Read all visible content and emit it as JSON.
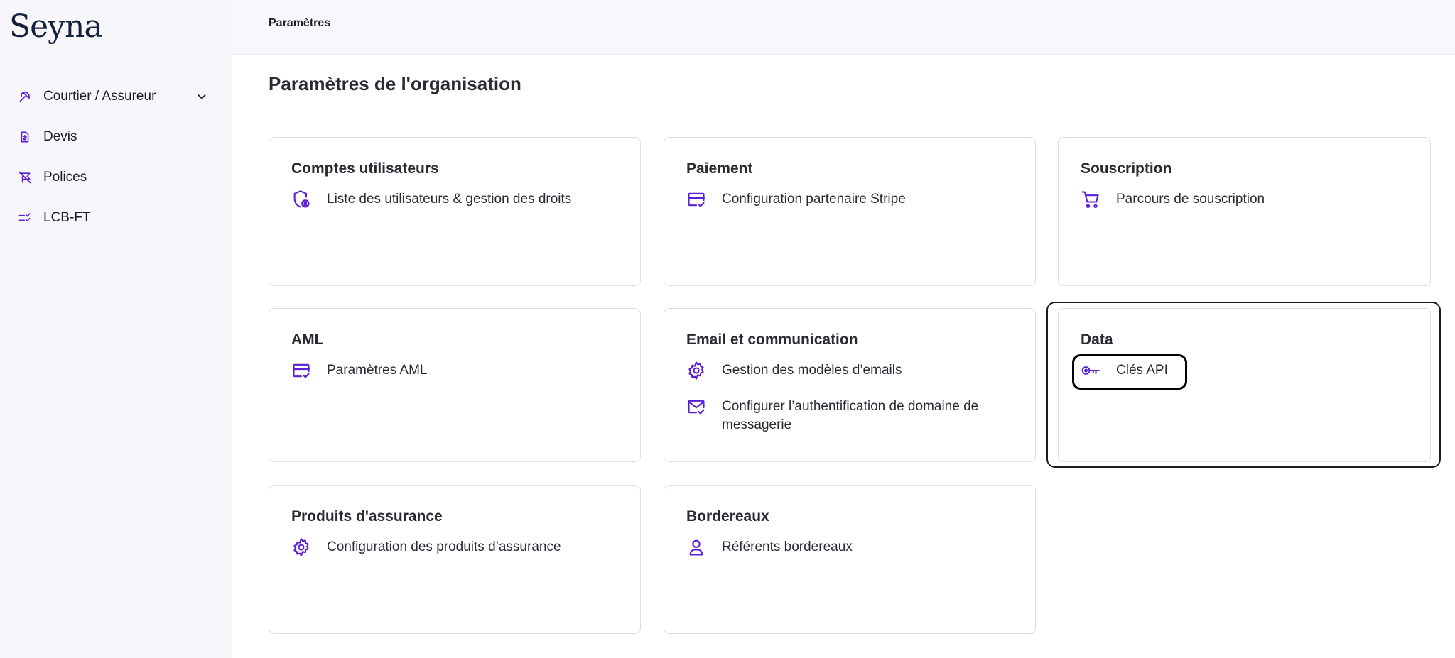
{
  "app": {
    "logo": "Seyna"
  },
  "sidebar": {
    "items": [
      {
        "label": "Courtier / Assureur",
        "icon": "umbrella-icon",
        "has_dropdown": true
      },
      {
        "label": "Devis",
        "icon": "document-icon"
      },
      {
        "label": "Polices",
        "icon": "umbrella-off-icon"
      },
      {
        "label": "LCB-FT",
        "icon": "checklist-icon"
      }
    ]
  },
  "header": {
    "breadcrumb": "Paramètres"
  },
  "page": {
    "title": "Paramètres de l'organisation"
  },
  "cards": [
    {
      "title": "Comptes utilisateurs",
      "links": [
        {
          "label": "Liste des utilisateurs & gestion des droits",
          "icon": "shield-user-icon"
        }
      ]
    },
    {
      "title": "Paiement",
      "links": [
        {
          "label": "Configuration partenaire Stripe",
          "icon": "credit-card-check-icon"
        }
      ]
    },
    {
      "title": "Souscription",
      "links": [
        {
          "label": "Parcours de souscription",
          "icon": "cart-icon"
        }
      ]
    },
    {
      "title": "AML",
      "links": [
        {
          "label": "Paramètres AML",
          "icon": "credit-card-check-icon"
        }
      ]
    },
    {
      "title": "Email et communication",
      "links": [
        {
          "label": "Gestion des modèles d’emails",
          "icon": "gear-icon"
        },
        {
          "label": "Configurer l’authentification de domaine de messagerie",
          "icon": "mail-check-icon"
        }
      ]
    },
    {
      "title": "Data",
      "links": [
        {
          "label": "Clés API",
          "icon": "key-icon"
        }
      ]
    },
    {
      "title": "Produits d'assurance",
      "links": [
        {
          "label": "Configuration des produits d’assurance",
          "icon": "gear-icon"
        }
      ]
    },
    {
      "title": "Bordereaux",
      "links": [
        {
          "label": "Référents bordereaux",
          "icon": "person-icon"
        }
      ]
    }
  ],
  "colors": {
    "accent": "#5b1fd6",
    "sidebar_bg": "#f7f6fb",
    "border": "#dedce6"
  }
}
